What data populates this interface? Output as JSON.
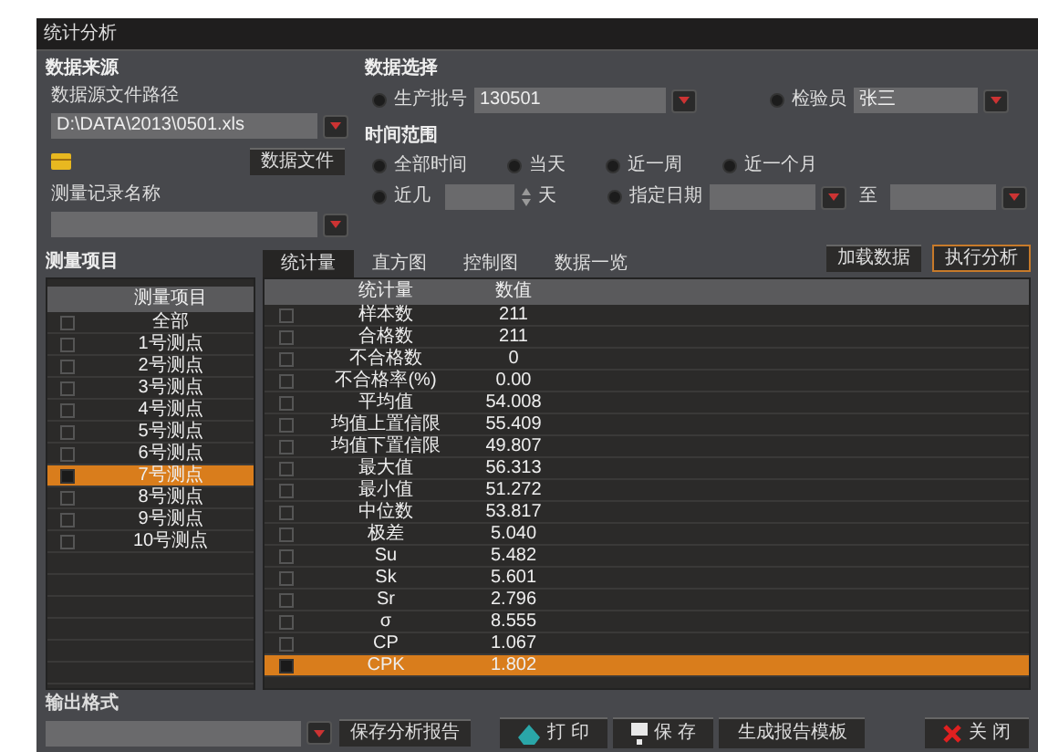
{
  "window": {
    "title": "统计分析"
  },
  "data_source": {
    "title": "数据来源",
    "path_label": "数据源文件路径",
    "path_value": "D:\\DATA\\2013\\0501.xls",
    "browse_button": "数据文件",
    "record_label": "测量记录名称"
  },
  "data_selection": {
    "title": "数据选择",
    "filters": [
      {
        "label": "生产批号",
        "value": "130501",
        "selected": false
      },
      {
        "label": "检验员",
        "value": "张三",
        "selected": false
      }
    ]
  },
  "time_range": {
    "title": "时间范围",
    "options": [
      {
        "label": "全部时间",
        "selected": false
      },
      {
        "label": "当天",
        "selected": false
      },
      {
        "label": "近一周",
        "selected": false
      },
      {
        "label": "近一个月",
        "selected": false
      }
    ],
    "recent": {
      "label": "近几",
      "unit": "天",
      "selected": false
    },
    "range": {
      "label": "指定日期",
      "to": "至",
      "selected": false
    }
  },
  "actions": [
    {
      "label": "加载数据",
      "primary": false
    },
    {
      "label": "执行分析",
      "primary": true
    }
  ],
  "items_panel": {
    "title": "测量项目",
    "header": "测量项目",
    "items": [
      {
        "label": "全部",
        "selected": false
      },
      {
        "label": "1号测点",
        "selected": false
      },
      {
        "label": "2号测点",
        "selected": false
      },
      {
        "label": "3号测点",
        "selected": false
      },
      {
        "label": "4号测点",
        "selected": false
      },
      {
        "label": "5号测点",
        "selected": false
      },
      {
        "label": "6号测点",
        "selected": false
      },
      {
        "label": "7号测点",
        "selected": true
      },
      {
        "label": "8号测点",
        "selected": false
      },
      {
        "label": "9号测点",
        "selected": false
      },
      {
        "label": "10号测点",
        "selected": false
      }
    ]
  },
  "tabs": [
    {
      "label": "统计量",
      "selected": true
    },
    {
      "label": "直方图",
      "selected": false
    },
    {
      "label": "控制图",
      "selected": false
    },
    {
      "label": "数据一览",
      "selected": false
    }
  ],
  "table": {
    "columns": [
      "统计量",
      "数值"
    ],
    "rows": [
      {
        "name": "样本数",
        "value": "211",
        "selected": false
      },
      {
        "name": "合格数",
        "value": "211",
        "selected": false
      },
      {
        "name": "不合格数",
        "value": "0",
        "selected": false
      },
      {
        "name": "不合格率(%)",
        "value": "0.00",
        "selected": false
      },
      {
        "name": "平均值",
        "value": "54.008",
        "selected": false
      },
      {
        "name": "均值上置信限",
        "value": "55.409",
        "selected": false
      },
      {
        "name": "均值下置信限",
        "value": "49.807",
        "selected": false
      },
      {
        "name": "最大值",
        "value": "56.313",
        "selected": false
      },
      {
        "name": "最小值",
        "value": "51.272",
        "selected": false
      },
      {
        "name": "中位数",
        "value": "53.817",
        "selected": false
      },
      {
        "name": "极差",
        "value": "5.040",
        "selected": false
      },
      {
        "name": "Su",
        "value": "5.482",
        "selected": false
      },
      {
        "name": "Sk",
        "value": "5.601",
        "selected": false
      },
      {
        "name": "Sr",
        "value": "2.796",
        "selected": false
      },
      {
        "name": "σ",
        "value": "8.555",
        "selected": false
      },
      {
        "name": "CP",
        "value": "1.067",
        "selected": false
      },
      {
        "name": "CPK",
        "value": "1.802",
        "selected": true
      }
    ]
  },
  "output": {
    "label": "输出格式",
    "save_report_button": "保存分析报告"
  },
  "footer_buttons": [
    {
      "kind": "print",
      "label": "打 印"
    },
    {
      "kind": "save",
      "label": "保 存"
    },
    {
      "kind": "plain",
      "label": "生成报告模板"
    },
    {
      "kind": "close",
      "label": "关 闭"
    }
  ]
}
